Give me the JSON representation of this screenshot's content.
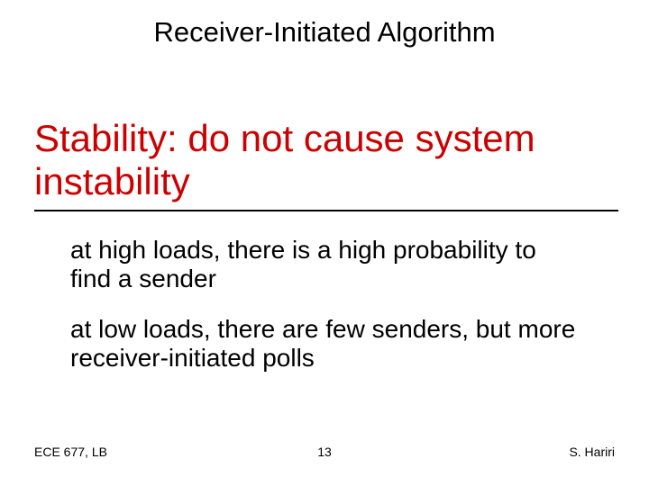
{
  "slide": {
    "title": "Receiver-Initiated Algorithm",
    "heading": "Stability: do not cause system instability",
    "bullets": [
      "at high loads, there is a high probability to find a sender",
      "at low loads, there are few senders, but more receiver-initiated polls"
    ],
    "footer": {
      "left": "ECE 677, LB",
      "center": "13",
      "right": "S. Hariri"
    }
  }
}
